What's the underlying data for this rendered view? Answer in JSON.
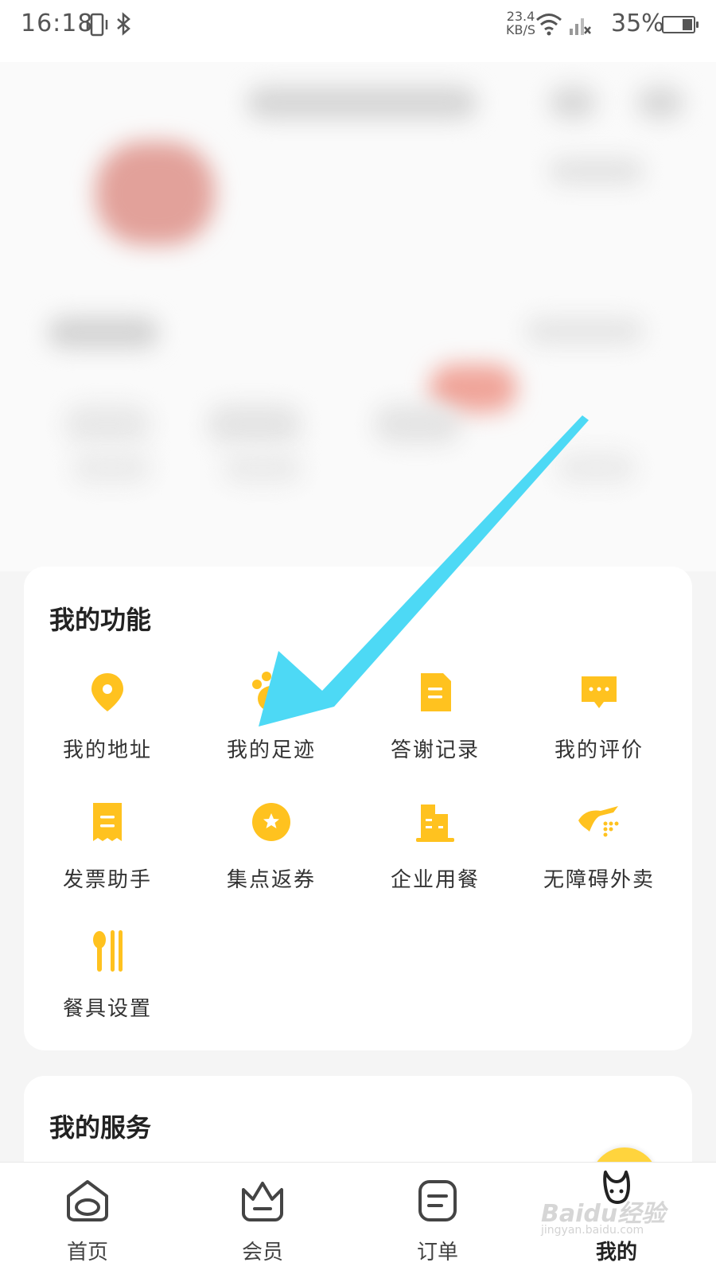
{
  "status_bar": {
    "time": "16:18",
    "net_speed_value": "23.4",
    "net_speed_unit": "KB/S",
    "battery_percent": "35%",
    "battery_level": 0.35
  },
  "colors": {
    "accent": "#ffc21f",
    "annotation_arrow": "#4dd9f5"
  },
  "functions_card": {
    "title": "我的功能",
    "items": [
      {
        "label": "我的地址",
        "icon": "location-pin-icon"
      },
      {
        "label": "我的足迹",
        "icon": "paw-print-icon"
      },
      {
        "label": "答谢记录",
        "icon": "document-icon"
      },
      {
        "label": "我的评价",
        "icon": "chat-bubble-icon"
      },
      {
        "label": "发票助手",
        "icon": "receipt-icon"
      },
      {
        "label": "集点返券",
        "icon": "star-coin-icon"
      },
      {
        "label": "企业用餐",
        "icon": "building-icon"
      },
      {
        "label": "无障碍外卖",
        "icon": "accessibility-hand-icon"
      },
      {
        "label": "餐具设置",
        "icon": "cutlery-icon"
      }
    ]
  },
  "services_card": {
    "title": "我的服务"
  },
  "bottom_nav": {
    "items": [
      {
        "label": "首页",
        "icon": "home-face-icon"
      },
      {
        "label": "会员",
        "icon": "crown-icon"
      },
      {
        "label": "订单",
        "icon": "order-list-icon"
      },
      {
        "label": "我的",
        "icon": "kangaroo-avatar-icon",
        "active": true
      }
    ]
  },
  "watermark": {
    "text": "Baidu经验",
    "sub": "jingyan.baidu.com"
  }
}
